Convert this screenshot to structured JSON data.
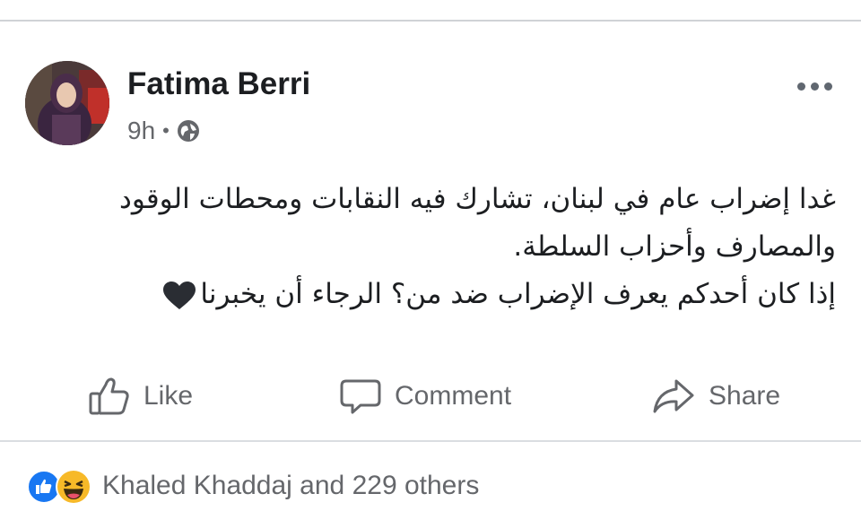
{
  "post": {
    "author": "Fatima Berri",
    "time": "9h",
    "separator": "•",
    "audience_icon": "globe-icon",
    "body_lines": [
      "غدا إضراب عام في لبنان، تشارك فيه النقابات ومحطات الوقود",
      "والمصارف وأحزاب السلطة.",
      "إذا كان أحدكم يعرف الإضراب ضد من؟ الرجاء أن يخبرنا"
    ],
    "trailing_emoji": "black-heart-icon"
  },
  "actions": {
    "like_label": "Like",
    "comment_label": "Comment",
    "share_label": "Share"
  },
  "reactions": {
    "icons": [
      "like-reaction-icon",
      "haha-reaction-icon"
    ],
    "summary": "Khaled Khaddaj and 229 others"
  },
  "colors": {
    "primary_text": "#1c1e21",
    "secondary_text": "#65676b",
    "like_blue": "#1877f2",
    "haha_yellow": "#f7b928",
    "divider": "#dadde1"
  }
}
